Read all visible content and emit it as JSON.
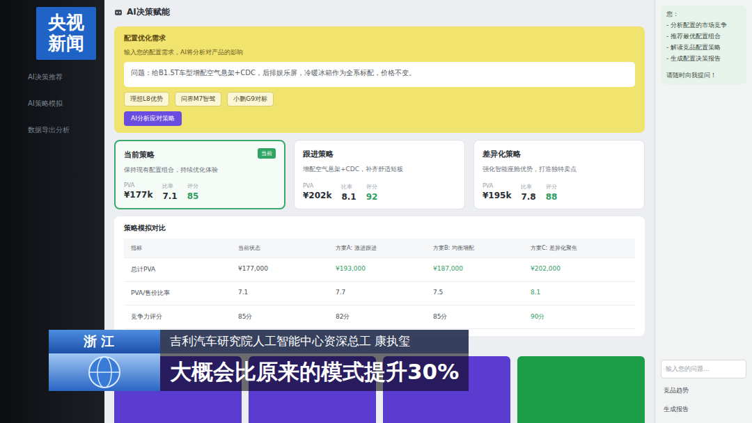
{
  "logo": {
    "top": "央视",
    "bottom": "新闻"
  },
  "sidebar": {
    "items": [
      {
        "label": "AI决策推荐"
      },
      {
        "label": "AI策略模拟"
      },
      {
        "label": "数据导出分析"
      }
    ]
  },
  "panel": {
    "title": "AI决策赋能"
  },
  "query": {
    "label": "配置优化需求",
    "hint": "输入您的配置需求，AI将分析对产品的影响",
    "text": "问题：给B1.5T车型增配空气悬架+CDC，后排娱乐屏，冷暖冰箱作为全系标配，价格不变。",
    "chips": [
      "理想L8优势",
      "问界M7智驾",
      "小鹏G9对标"
    ],
    "button": "AI分析应对策略"
  },
  "strategies": [
    {
      "title": "当前策略",
      "badge": "当前",
      "selected": true,
      "desc": "保持现有配置组合，持续优化体验",
      "stats": [
        {
          "label": "PVA",
          "value": "¥177k",
          "highlight": false
        },
        {
          "label": "比率",
          "value": "7.1",
          "highlight": false
        },
        {
          "label": "评分",
          "value": "85",
          "highlight": true
        }
      ]
    },
    {
      "title": "跟进策略",
      "badge": "",
      "selected": false,
      "desc": "增配空气悬架+CDC，补齐舒适短板",
      "stats": [
        {
          "label": "PVA",
          "value": "¥202k",
          "highlight": false
        },
        {
          "label": "比率",
          "value": "8.1",
          "highlight": false
        },
        {
          "label": "评分",
          "value": "92",
          "highlight": true
        }
      ]
    },
    {
      "title": "差异化策略",
      "badge": "",
      "selected": false,
      "desc": "强化智能座舱优势，打造独特卖点",
      "stats": [
        {
          "label": "PVA",
          "value": "¥195k",
          "highlight": false
        },
        {
          "label": "比率",
          "value": "7.8",
          "highlight": false
        },
        {
          "label": "评分",
          "value": "88",
          "highlight": true
        }
      ]
    }
  ],
  "table": {
    "title": "策略模拟对比",
    "columns": [
      "指标",
      "当前状态",
      "方案A: 激进跟进",
      "方案B: 均衡增配",
      "方案C: 差异化聚焦"
    ],
    "rows": [
      {
        "cells": [
          {
            "text": "总计PVA",
            "highlight": false
          },
          {
            "text": "¥177,000",
            "highlight": false
          },
          {
            "text": "¥193,000",
            "highlight": true
          },
          {
            "text": "¥187,000",
            "highlight": true
          },
          {
            "text": "¥202,000",
            "highlight": true
          }
        ]
      },
      {
        "cells": [
          {
            "text": "PVA/售价比率",
            "highlight": false
          },
          {
            "text": "7.1",
            "highlight": false
          },
          {
            "text": "7.7",
            "highlight": false
          },
          {
            "text": "7.5",
            "highlight": false
          },
          {
            "text": "8.1",
            "highlight": true
          }
        ]
      },
      {
        "cells": [
          {
            "text": "竞争力评分",
            "highlight": false
          },
          {
            "text": "85分",
            "highlight": false
          },
          {
            "text": "82分",
            "highlight": false
          },
          {
            "text": "85分",
            "highlight": false
          },
          {
            "text": "90分",
            "highlight": true
          }
        ]
      }
    ]
  },
  "actions": [
    {
      "color": "#5a3dd0"
    },
    {
      "color": "#5a3dd0"
    },
    {
      "color": "#5a3dd0"
    },
    {
      "color": "#1c9e48"
    }
  ],
  "chat": {
    "greeting": "您：",
    "items": [
      "- 分析配置的市场竞争",
      "- 推荐最优配置组合",
      "- 解读竞品配置策略",
      "- 生成配置决策报告"
    ],
    "closing": "请随时向我提问！",
    "placeholder": "输入您的问题...",
    "buttons": [
      "竞品趋势",
      "生成报告"
    ]
  },
  "caption": {
    "location": "浙江",
    "speaker": "吉利汽车研究院人工智能中心资深总工 康执玺",
    "quote": "大概会比原来的模式提升30%"
  }
}
